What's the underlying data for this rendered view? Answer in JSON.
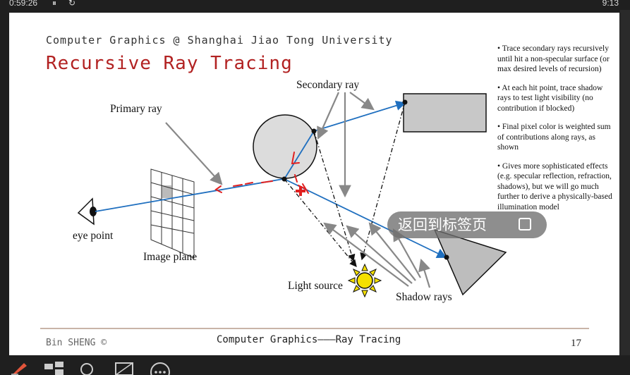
{
  "topbar": {
    "elapsed": "0:59:26",
    "pause_icon": "pause-icon",
    "reset_icon": "reset-icon",
    "clock": "9:13"
  },
  "slide": {
    "course": "Computer Graphics @ Shanghai Jiao Tong University",
    "title": "Recursive Ray Tracing",
    "bullets": [
      "• Trace secondary rays recursively until hit a non-specular surface (or max desired levels of recursion)",
      "• At each hit point, trace shadow rays to test light visibility (no contribution if blocked)",
      "• Final pixel color is weighted sum of contributions along rays, as shown",
      "• Gives more sophisticated effects (e.g. specular reflection, refraction, shadows), but we will go much further to derive a physically-based illumination model"
    ],
    "diagram_labels": {
      "primary_ray": "Primary ray",
      "secondary_ray": "Secondary ray",
      "eye_point": "eye point",
      "image_plane": "Image plane",
      "light_source": "Light source",
      "shadow_rays": "Shadow rays"
    },
    "footer": {
      "author": "Bin  SHENG ©",
      "center": "Computer Graphics———Ray Tracing",
      "page": "17"
    }
  },
  "toast": {
    "label": "返回到标签页"
  },
  "colors": {
    "title": "#b22222",
    "ray": "#1f6fbf",
    "annotation": "#e02020",
    "object_fill": "#c8c8c8"
  },
  "bottombar_icons": [
    "pen-icon",
    "slides-grid-icon",
    "zoom-icon",
    "screen-icon",
    "more-icon"
  ]
}
